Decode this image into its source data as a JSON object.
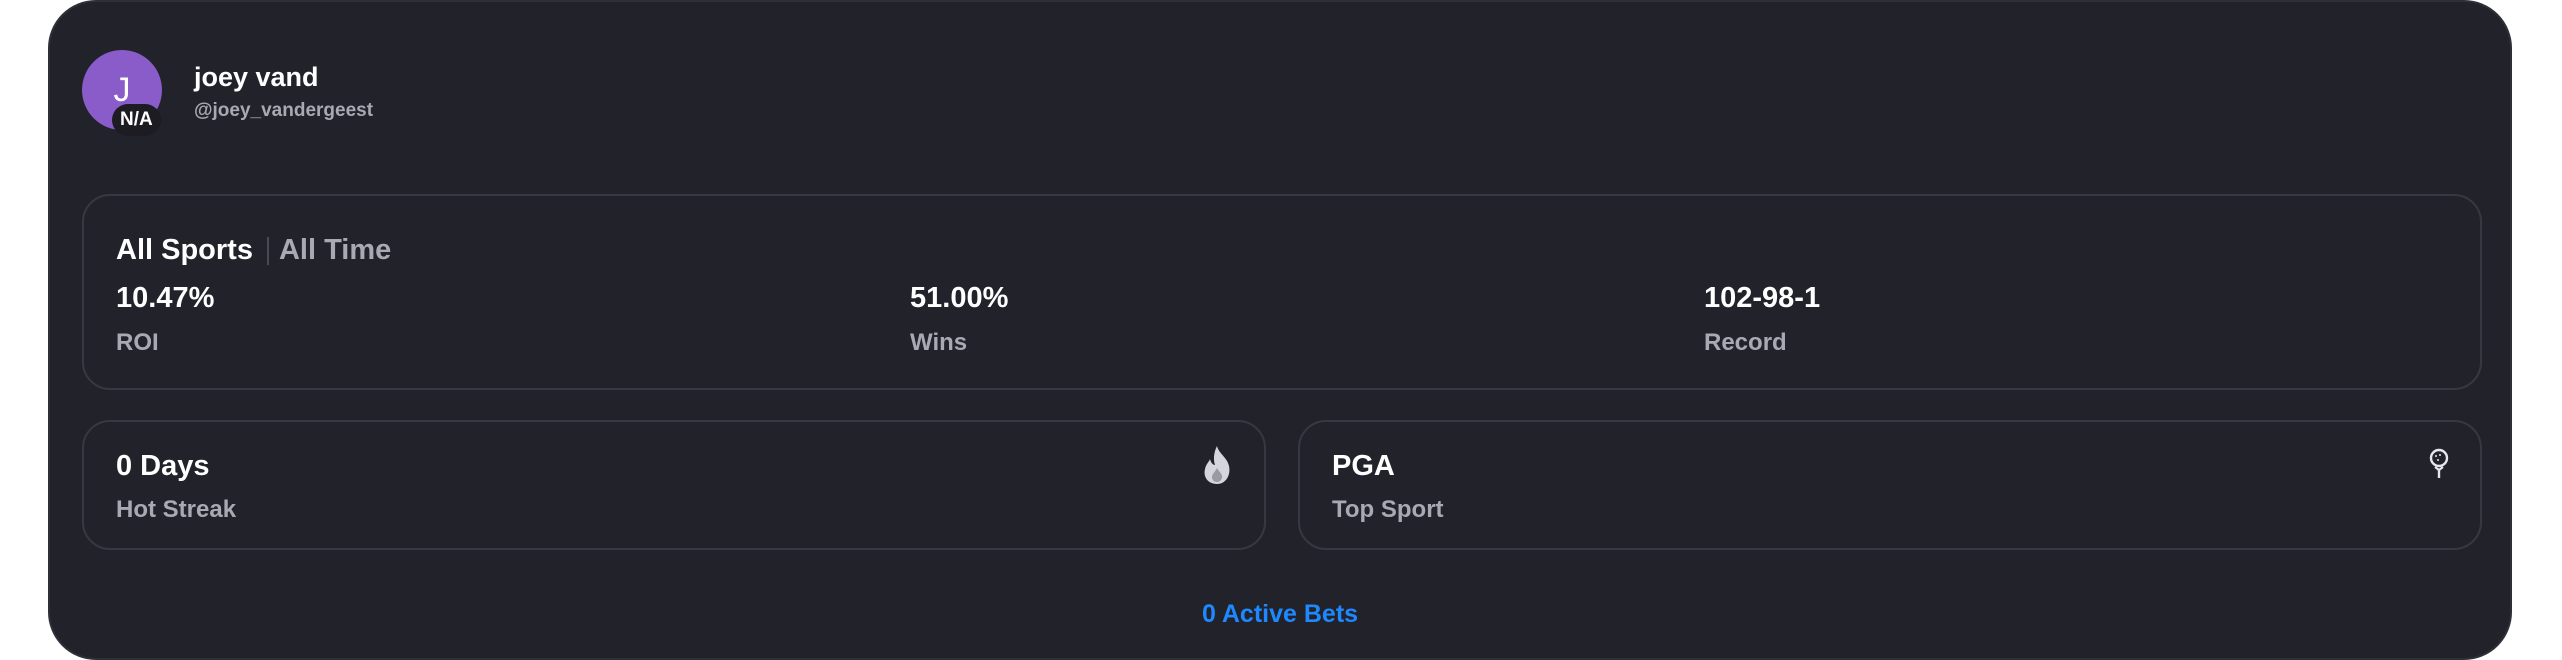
{
  "profile": {
    "avatar_initial": "J",
    "avatar_badge": "N/A",
    "name": "joey vand",
    "handle": "@joey_vandergeest",
    "avatar_color": "#8a5cc9"
  },
  "filters": {
    "sport": "All Sports",
    "period": "All Time"
  },
  "stats": [
    {
      "value": "10.47%",
      "label": "ROI"
    },
    {
      "value": "51.00%",
      "label": "Wins"
    },
    {
      "value": "102-98-1",
      "label": "Record"
    }
  ],
  "streak": {
    "value": "0 Days",
    "label": "Hot Streak",
    "icon": "fire-icon"
  },
  "top_sport": {
    "value": "PGA",
    "label": "Top Sport",
    "icon": "golf-icon"
  },
  "active_bets": "0 Active Bets",
  "colors": {
    "background": "#22222a",
    "accent": "#1e88ff",
    "muted_text": "#a9a9b3"
  }
}
